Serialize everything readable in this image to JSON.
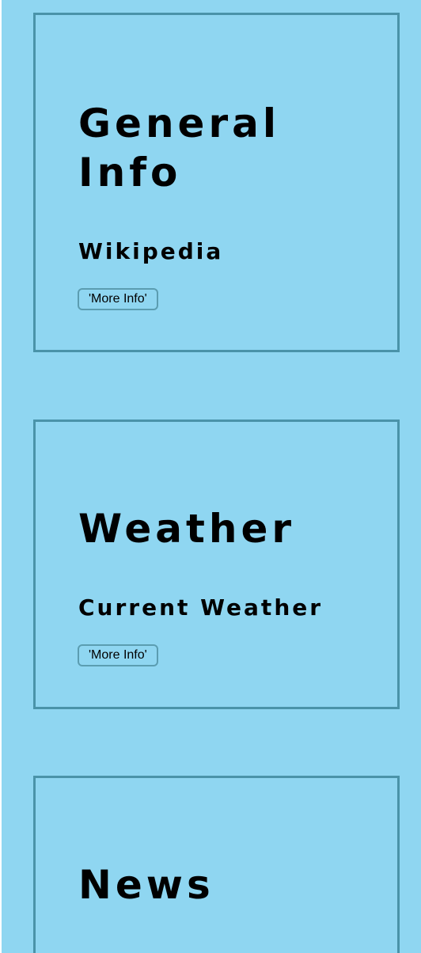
{
  "cards": [
    {
      "title": "General Info",
      "subtitle": "Wikipedia",
      "button_label": "'More Info'"
    },
    {
      "title": "Weather",
      "subtitle": "Current Weather",
      "button_label": "'More Info'"
    },
    {
      "title": "News"
    }
  ],
  "colors": {
    "background": "#8fd6f1",
    "card_border": "#4a93a9",
    "button_border": "#5b9db1",
    "text": "#000000"
  }
}
